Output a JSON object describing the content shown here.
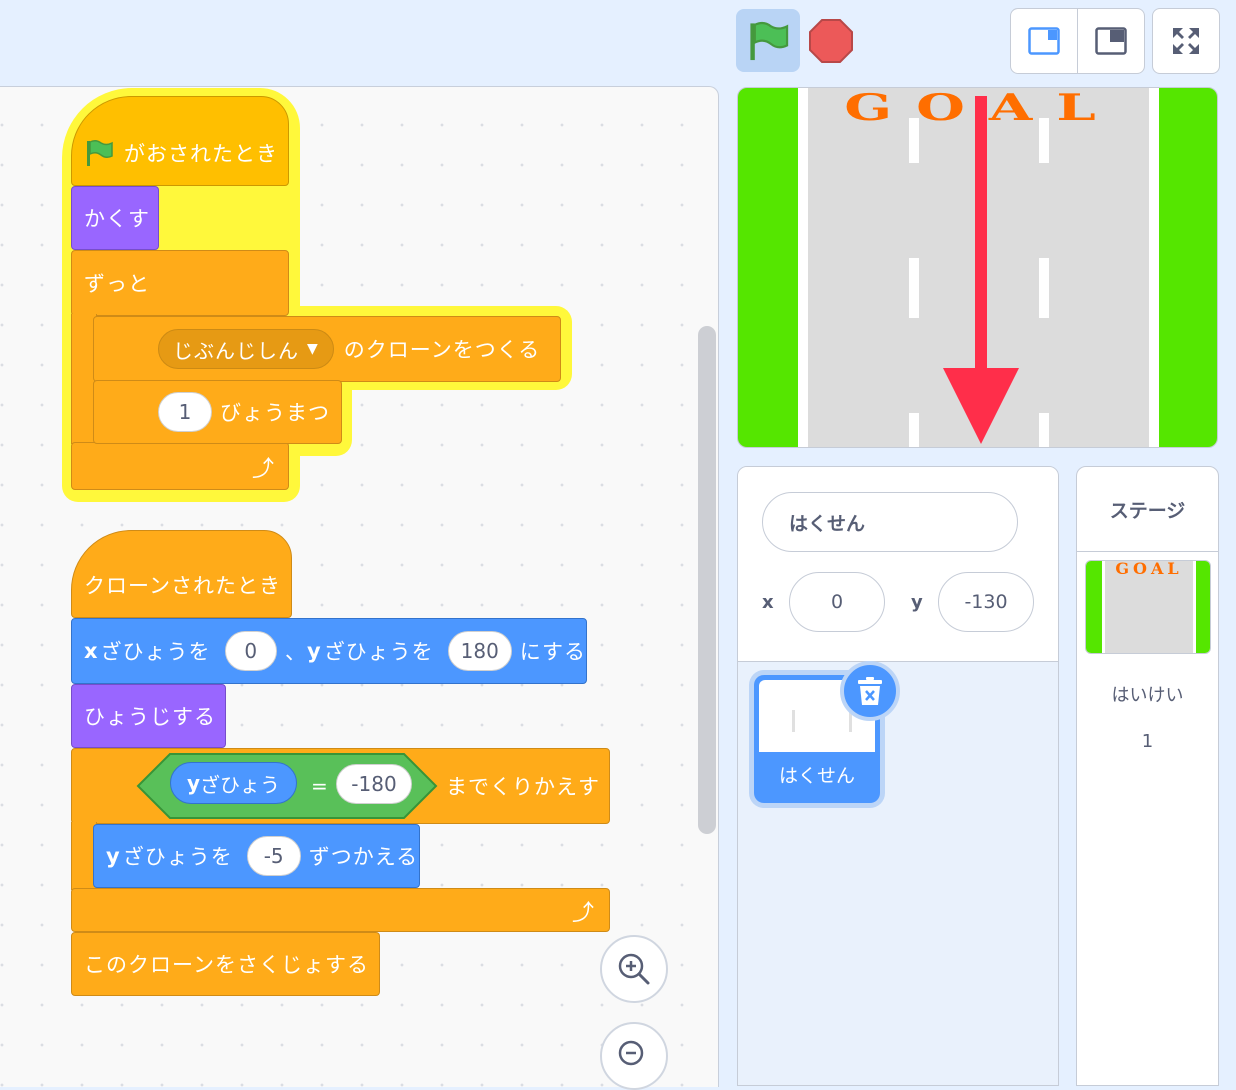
{
  "script1": {
    "flag_hat": "がおされたとき",
    "hide": "かくす",
    "forever": "ずっと",
    "clone_self_option": "じぶんじしん",
    "clone_create_suffix": "のクローンをつくる",
    "wait_value": "1",
    "wait_suffix": "びょうまつ"
  },
  "script2": {
    "clone_hat": "クローンされたとき",
    "goto_x_label": "ざひょうを",
    "goto_x_value": "0",
    "goto_sep": "、",
    "goto_y_label": "ざひょうを",
    "goto_y_value": "180",
    "goto_suffix": "にする",
    "show": "ひょうじする",
    "repeat_var": "ざひょう",
    "repeat_op": "=",
    "repeat_value": "-180",
    "repeat_suffix": "までくりかえす",
    "change_y_label": "ざひょうを",
    "change_y_value": "-5",
    "change_y_suffix": "ずつかえる",
    "delete_clone": "このクローンをさくじょする"
  },
  "stage": {
    "goal_text": "GOAL"
  },
  "sprite_info": {
    "name": "はくせん",
    "x_label": "x",
    "x_value": "0",
    "y_label": "y",
    "y_value": "-130"
  },
  "sprite_list": [
    {
      "name": "はくせん"
    }
  ],
  "stage_panel": {
    "title": "ステージ",
    "backdrop_label": "はいけい",
    "backdrop_count": "1"
  },
  "colors": {
    "events": "#ffbf00",
    "control": "#ffab19",
    "looks": "#9966ff",
    "motion": "#4c97ff",
    "operators": "#59c059",
    "grass": "#55e600",
    "goal": "#ff6e00",
    "arrow": "#ff2e4a"
  }
}
